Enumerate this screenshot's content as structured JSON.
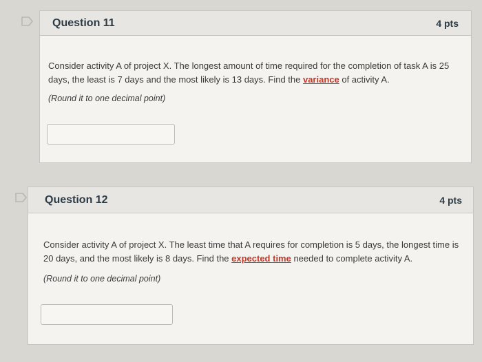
{
  "questions": [
    {
      "title": "Question 11",
      "points": "4 pts",
      "text_before": "Consider activity A of project X. The longest amount of time required for the completion of task A is 25 days, the least is 7 days and the most likely is 13 days. Find the ",
      "link_text": "variance",
      "text_after": " of activity A.",
      "note": "(Round it to one decimal point)",
      "answer_value": ""
    },
    {
      "title": "Question 12",
      "points": "4 pts",
      "text_before": "Consider activity A of project X. The least time that A requires for completion is 5 days, the longest time is 20 days, and the most likely is 8 days. Find the ",
      "link_text": "expected time",
      "text_after": " needed to complete activity A.",
      "note": "(Round it to one decimal point)",
      "answer_value": ""
    }
  ],
  "colors": {
    "link": "#c0392b",
    "background": "#d9d7d2",
    "panel": "#f4f3f0",
    "header": "#e7e6e3"
  },
  "icons": {
    "flag": "flag-question-icon"
  }
}
